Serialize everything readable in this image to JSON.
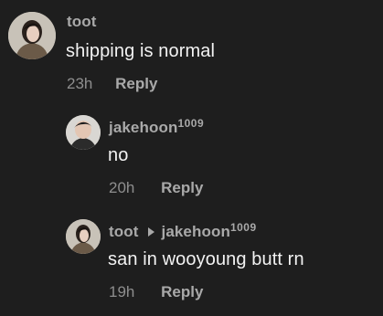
{
  "comments": [
    {
      "username": "toot",
      "text": "shipping is normal",
      "time": "23h",
      "reply_label": "Reply"
    },
    {
      "username": "jakehoon",
      "username_suffix": "1009",
      "text": "no",
      "time": "20h",
      "reply_label": "Reply"
    },
    {
      "username": "toot",
      "reply_to": "jakehoon",
      "reply_to_suffix": "1009",
      "text": "san in wooyoung butt rn",
      "time": "19h",
      "reply_label": "Reply"
    }
  ],
  "colors": {
    "background": "#1e1e1e",
    "username": "#a9a9a9",
    "text": "#f2f2f2",
    "time": "#8e8e8e"
  }
}
